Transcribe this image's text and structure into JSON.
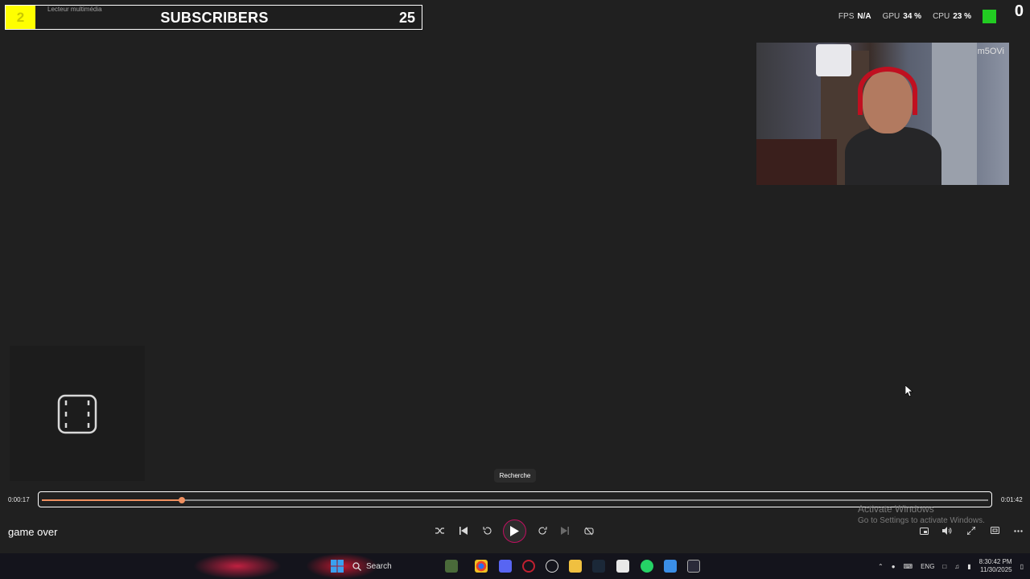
{
  "overlay": {
    "subscriber_bar": {
      "badge_number": "2",
      "app_title": "Lecteur multimédia",
      "label": "SUBSCRIBERS",
      "count": "25"
    },
    "stats": [
      {
        "label": "FPS",
        "value": "N/A"
      },
      {
        "label": "GPU",
        "value": "34 %"
      },
      {
        "label": "CPU",
        "value": "23 %"
      }
    ],
    "window_caption": "0",
    "webcam_watermark": "m5OVi"
  },
  "player": {
    "tooltip": "Recherche",
    "current_time": "0:00:17",
    "total_time": "0:01:42",
    "progress_fraction": 0.1483,
    "track_title": "game over",
    "controls": [
      "shuffle-icon",
      "previous-icon",
      "rewind-10-icon",
      "play-icon",
      "forward-30-icon",
      "next-icon",
      "repeat-icon"
    ],
    "right_controls": [
      "miniplayer-icon",
      "volume-icon",
      "fullscreen-icon",
      "cast-icon",
      "more-icon"
    ]
  },
  "watermark": {
    "line1": "Activate Windows",
    "line2": "Go to Settings to activate Windows."
  },
  "taskbar": {
    "search_label": "Search",
    "language": "ENG",
    "time": "8:30:42 PM",
    "date": "11/30/2025"
  },
  "colors": {
    "accent": "#f09060",
    "badge": "#ffff00",
    "background": "#202020",
    "play_ring": "#c01060"
  }
}
